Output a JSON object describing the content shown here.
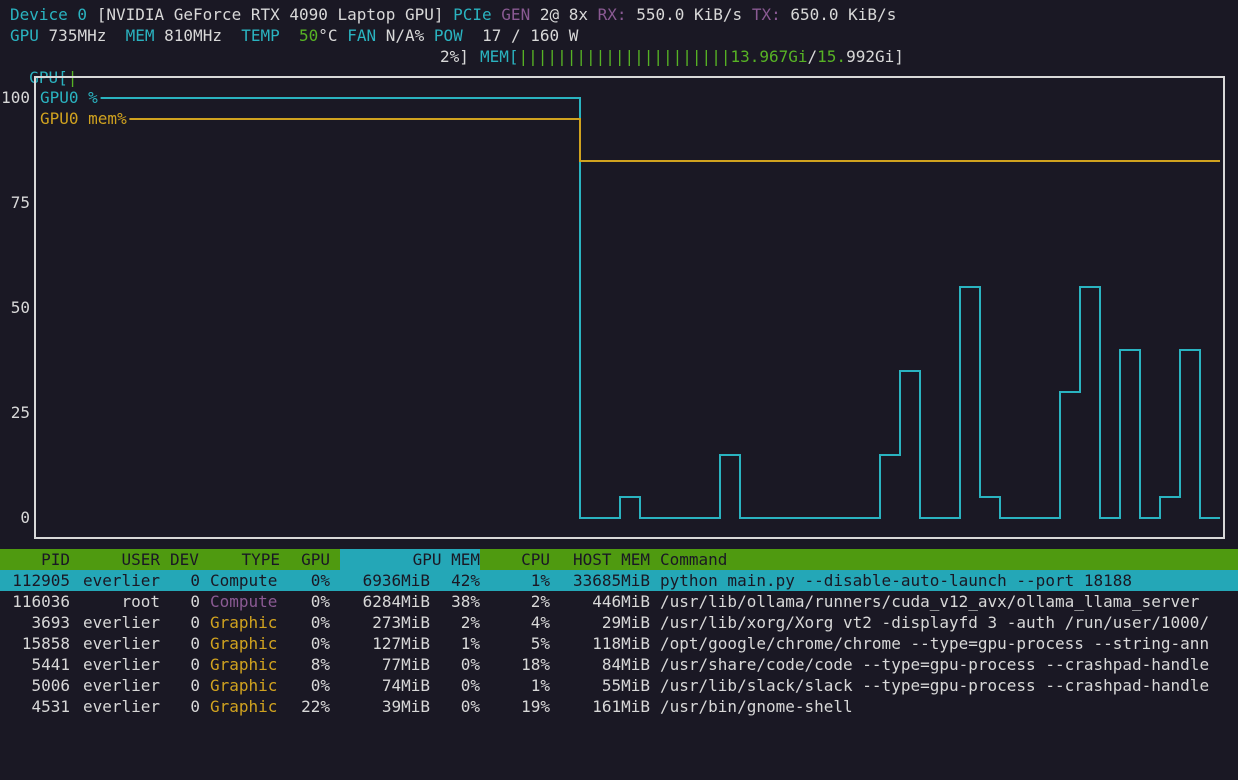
{
  "device": {
    "label": "Device 0",
    "name": "[NVIDIA GeForce RTX 4090 Laptop GPU]",
    "pcie_label": "PCIe",
    "gen_label": "GEN",
    "gen_value": "2@ 8x",
    "rx_label": "RX:",
    "rx_value": "550.0 KiB/s",
    "tx_label": "TX:",
    "tx_value": "650.0 KiB/s"
  },
  "stats": {
    "gpu_label": "GPU",
    "gpu_clock": "735MHz",
    "mem_label": "MEM",
    "mem_clock": "810MHz",
    "temp_label": "TEMP",
    "temp_value": "50",
    "temp_unit": "°C",
    "fan_label": "FAN",
    "fan_value": "N/A%",
    "pow_label": "POW",
    "pow_value": "17 / 160 W"
  },
  "bars": {
    "gpu_label": "GPU[",
    "gpu_bar": "|",
    "gpu_pct": "2%]",
    "mem_label": "MEM[",
    "mem_bar": "||||||||||||||||||||||",
    "mem_used": "13.967Gi",
    "mem_sep": "/",
    "mem_total_green": "15.",
    "mem_total_white": "992Gi]",
    "gpu_fraction": 0.02,
    "mem_fraction": 0.874
  },
  "colors": {
    "cyan": "#2ab3c0",
    "yellow": "#d0a21f",
    "green": "#57b325",
    "purple": "#8a5a93",
    "background": "#1a1824"
  },
  "chart_data": {
    "type": "line",
    "ylim": [
      0,
      100
    ],
    "y_ticks": [
      "100",
      "75",
      "50",
      "25",
      "0"
    ],
    "step": true,
    "series": [
      {
        "name": "GPU0 %",
        "color": "#2ab3c0",
        "values": [
          null,
          null,
          null,
          null,
          null,
          null,
          null,
          null,
          null,
          null,
          null,
          null,
          null,
          null,
          null,
          null,
          null,
          null,
          null,
          null,
          null,
          null,
          null,
          null,
          null,
          null,
          null,
          null,
          100,
          0,
          0,
          5,
          0,
          0,
          0,
          0,
          15,
          0,
          0,
          0,
          0,
          0,
          0,
          0,
          15,
          35,
          0,
          0,
          55,
          5,
          0,
          0,
          0,
          30,
          55,
          0,
          40,
          0,
          5,
          40,
          0
        ]
      },
      {
        "name": "GPU0 mem%",
        "color": "#d0a21f",
        "values": [
          null,
          null,
          null,
          null,
          null,
          null,
          null,
          null,
          null,
          null,
          null,
          null,
          null,
          null,
          null,
          null,
          null,
          null,
          null,
          null,
          null,
          null,
          null,
          null,
          null,
          null,
          null,
          null,
          95,
          85,
          85,
          85,
          85,
          85,
          85,
          85,
          85,
          85,
          85,
          85,
          85,
          85,
          85,
          85,
          85,
          85,
          85,
          85,
          85,
          85,
          85,
          85,
          85,
          85,
          85,
          85,
          85,
          85,
          85,
          85,
          85
        ]
      }
    ]
  },
  "table": {
    "columns": [
      "PID",
      "USER",
      "DEV",
      "TYPE",
      "GPU",
      "GPU MEM",
      "CPU",
      "HOST MEM",
      "Command"
    ],
    "rows": [
      {
        "pid": "112905",
        "user": "everlier",
        "dev": "0",
        "type": "Compute",
        "gpu": "0%",
        "gpu_mem": "6936MiB",
        "gpu_mem_pct": "42%",
        "cpu": "1%",
        "host_mem": "33685MiB",
        "command": "python main.py --disable-auto-launch --port 18188"
      },
      {
        "pid": "116036",
        "user": "root",
        "dev": "0",
        "type": "Compute",
        "gpu": "0%",
        "gpu_mem": "6284MiB",
        "gpu_mem_pct": "38%",
        "cpu": "2%",
        "host_mem": "446MiB",
        "command": "/usr/lib/ollama/runners/cuda_v12_avx/ollama_llama_server"
      },
      {
        "pid": "3693",
        "user": "everlier",
        "dev": "0",
        "type": "Graphic",
        "gpu": "0%",
        "gpu_mem": "273MiB",
        "gpu_mem_pct": "2%",
        "cpu": "4%",
        "host_mem": "29MiB",
        "command": "/usr/lib/xorg/Xorg vt2 -displayfd 3 -auth /run/user/1000/"
      },
      {
        "pid": "15858",
        "user": "everlier",
        "dev": "0",
        "type": "Graphic",
        "gpu": "0%",
        "gpu_mem": "127MiB",
        "gpu_mem_pct": "1%",
        "cpu": "5%",
        "host_mem": "118MiB",
        "command": "/opt/google/chrome/chrome --type=gpu-process --string-ann"
      },
      {
        "pid": "5441",
        "user": "everlier",
        "dev": "0",
        "type": "Graphic",
        "gpu": "8%",
        "gpu_mem": "77MiB",
        "gpu_mem_pct": "0%",
        "cpu": "18%",
        "host_mem": "84MiB",
        "command": "/usr/share/code/code --type=gpu-process --crashpad-handle"
      },
      {
        "pid": "5006",
        "user": "everlier",
        "dev": "0",
        "type": "Graphic",
        "gpu": "0%",
        "gpu_mem": "74MiB",
        "gpu_mem_pct": "0%",
        "cpu": "1%",
        "host_mem": "55MiB",
        "command": "/usr/lib/slack/slack --type=gpu-process --crashpad-handle"
      },
      {
        "pid": "4531",
        "user": "everlier",
        "dev": "0",
        "type": "Graphic",
        "gpu": "22%",
        "gpu_mem": "39MiB",
        "gpu_mem_pct": "0%",
        "cpu": "19%",
        "host_mem": "161MiB",
        "command": "/usr/bin/gnome-shell"
      }
    ]
  }
}
